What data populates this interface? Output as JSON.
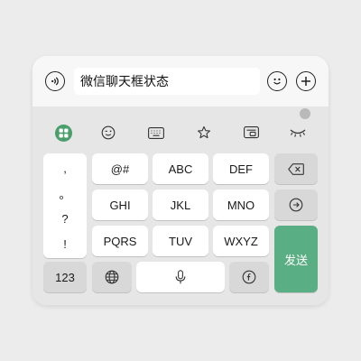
{
  "input_bar": {
    "text": "微信聊天框状态"
  },
  "keyboard": {
    "toolbar": {
      "icons": [
        "wechat-logo-icon",
        "emoji-wink-icon",
        "keyboard-icon",
        "star-icon",
        "clipboard-icon",
        "collapse-eye-icon"
      ]
    },
    "punctuation": [
      ",",
      "。",
      "?",
      "!"
    ],
    "keys": {
      "row1": [
        "@#",
        "ABC",
        "DEF"
      ],
      "row2": [
        "GHI",
        "JKL",
        "MNO"
      ],
      "row3": [
        "PQRS",
        "TUV",
        "WXYZ"
      ]
    },
    "bottom": {
      "numbers": "123"
    },
    "send_label": "发送"
  },
  "colors": {
    "send": "#5aae83",
    "wechat_green": "#4a9e6b"
  }
}
